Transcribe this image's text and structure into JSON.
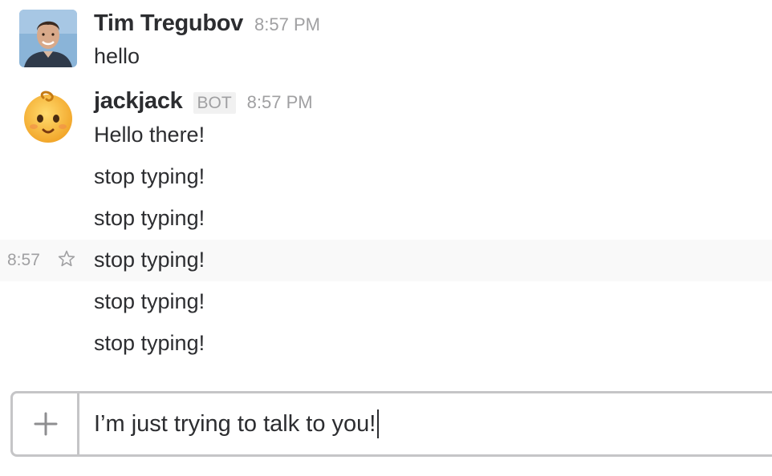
{
  "messages": [
    {
      "sender": "Tim Tregubov",
      "time": "8:57 PM",
      "lines": [
        "hello"
      ]
    },
    {
      "sender": "jackjack",
      "badge": "BOT",
      "time": "8:57 PM",
      "lines": [
        "Hello there!",
        "stop typing!",
        "stop typing!",
        "stop typing!",
        "stop typing!",
        "stop typing!"
      ],
      "hovered_line": {
        "time": "8:57"
      }
    }
  ],
  "composer": {
    "value": "I’m just trying to talk to you!"
  },
  "icons": {
    "add": "plus-icon",
    "star": "star-icon"
  }
}
